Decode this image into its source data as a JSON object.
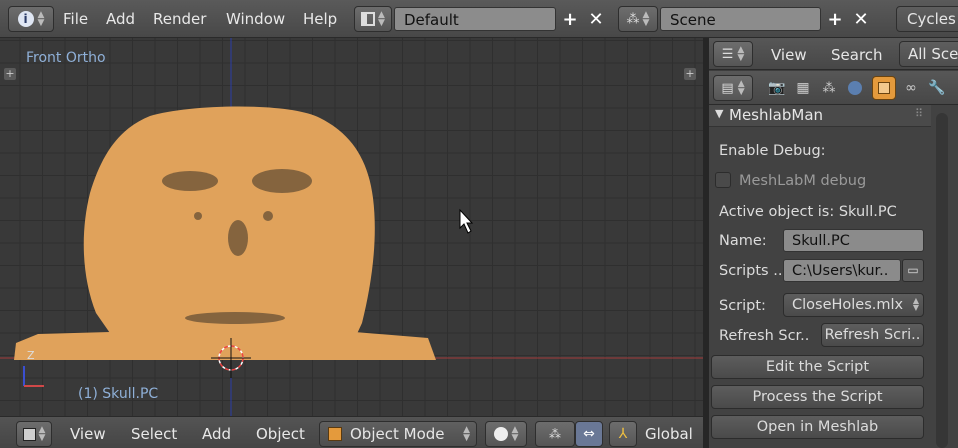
{
  "top_menu": {
    "items": [
      "File",
      "Add",
      "Render",
      "Window",
      "Help"
    ],
    "layout_name": "Default",
    "scene_name": "Scene",
    "engine": "Cycles"
  },
  "viewport": {
    "view_name": "Front Ortho",
    "object_label": "(1) Skull.PC",
    "axis_z": "Z",
    "colors": {
      "mesh": "#e0a25b",
      "x_axis": "#b23a3a",
      "z_axis": "#2a3da8",
      "grid": "#2f2f2f"
    }
  },
  "bottom_bar": {
    "menus": [
      "View",
      "Select",
      "Add",
      "Object"
    ],
    "mode": "Object Mode",
    "orientation": "Global"
  },
  "outliner_header": {
    "view": "View",
    "search": "Search",
    "filter": "All Sce"
  },
  "properties": {
    "panel_title": "MeshlabMan",
    "enable_debug_label": "Enable Debug:",
    "debug_checkbox_label": "MeshLabM debug",
    "active_object_text": "Active object is: Skull.PC",
    "name_label": "Name:",
    "name_value": "Skull.PC",
    "scripts_label": "Scripts ..",
    "scripts_path": "C:\\Users\\kur..",
    "script_label": "Script:",
    "script_value": "CloseHoles.mlx",
    "refresh_label": "Refresh Scr..",
    "refresh_button": "Refresh Scri..",
    "edit_button": "Edit the Script",
    "process_button": "Process the Script",
    "open_button": "Open in Meshlab"
  }
}
